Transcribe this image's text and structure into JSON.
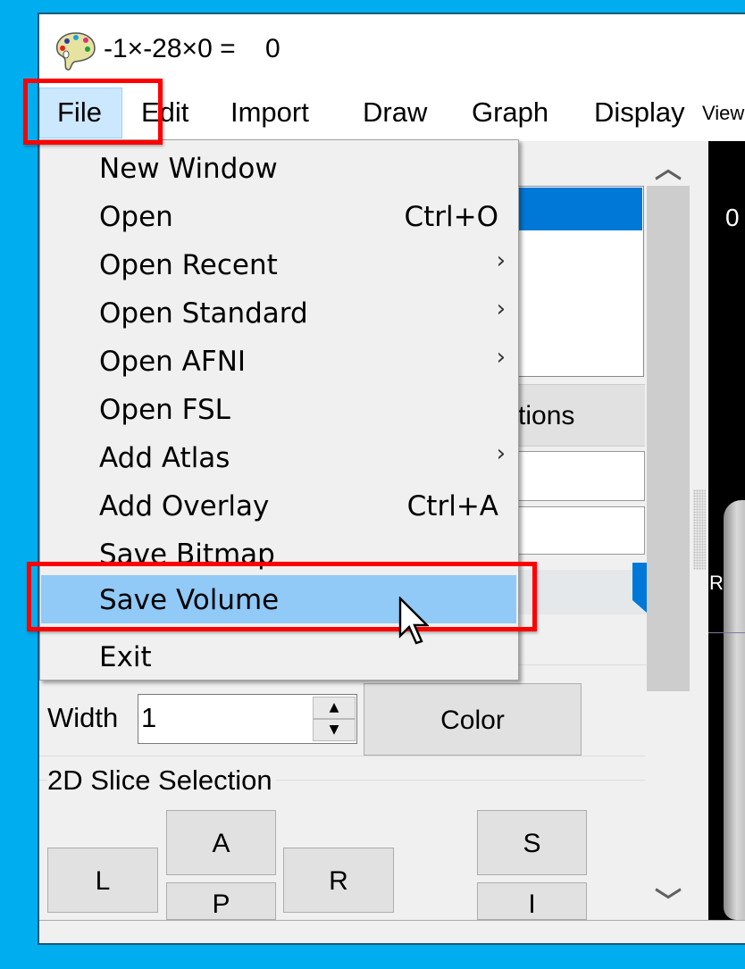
{
  "window": {
    "title": "-1×-28×0 =    0",
    "icon": "palette-icon"
  },
  "menubar": [
    "File",
    "Edit",
    "Import",
    "Draw",
    "Graph",
    "Display",
    "View"
  ],
  "file_menu": [
    {
      "label": "New Window",
      "shortcut": "",
      "submenu": false
    },
    {
      "label": "Open",
      "shortcut": "Ctrl+O",
      "submenu": false
    },
    {
      "label": "Open Recent",
      "shortcut": "",
      "submenu": true
    },
    {
      "label": "Open Standard",
      "shortcut": "",
      "submenu": true
    },
    {
      "label": "Open AFNI",
      "shortcut": "",
      "submenu": true
    },
    {
      "label": "Open FSL",
      "shortcut": "",
      "submenu": false
    },
    {
      "label": "Add Atlas",
      "shortcut": "",
      "submenu": true
    },
    {
      "label": "Add Overlay",
      "shortcut": "Ctrl+A",
      "submenu": false
    },
    {
      "label": "Save Bitmap",
      "shortcut": "",
      "submenu": false
    },
    {
      "label": "Save Volume",
      "shortcut": "",
      "submenu": false,
      "highlighted": true
    },
    {
      "label": "Exit",
      "shortcut": "",
      "submenu": false
    }
  ],
  "submenu_arrow": "›",
  "panel": {
    "options_button": "Options",
    "width_label": "Width",
    "width_value": "1",
    "color_button": "Color",
    "slice_group_label": "2D Slice Selection",
    "slice_buttons": {
      "L": "L",
      "A": "A",
      "P": "P",
      "R": "R",
      "S": "S",
      "I": "I"
    }
  },
  "viewer": {
    "orientation_label": "R",
    "top_label": "0"
  },
  "colors": {
    "highlight": "#91c9f7",
    "menu_hover": "#cce8ff",
    "selection": "#0078d7",
    "annotation": "#ff0000",
    "desktop": "#00adef"
  }
}
